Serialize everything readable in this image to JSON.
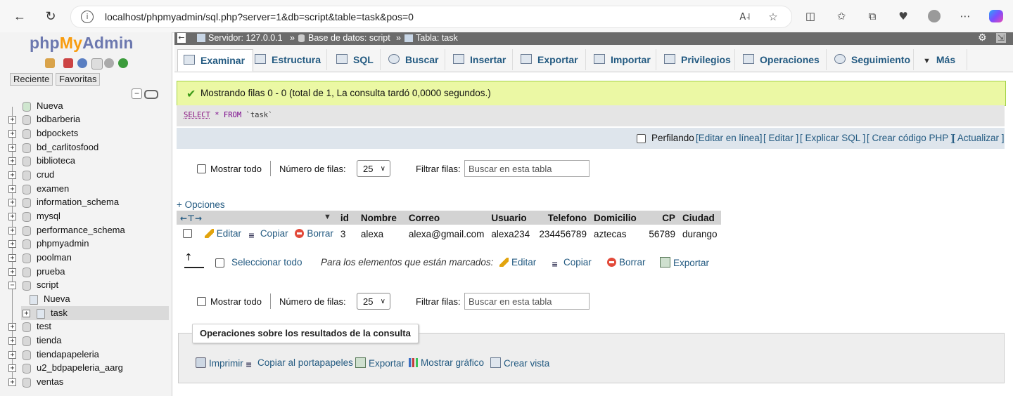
{
  "browser": {
    "url": "localhost/phpmyadmin/sql.php?server=1&db=script&table=task&pos=0"
  },
  "sidebar": {
    "logo": {
      "php": "php",
      "my": "My",
      "admin": "Admin"
    },
    "tabs": {
      "recent": "Reciente",
      "favorites": "Favoritas"
    },
    "tree": [
      {
        "label": "Nueva",
        "type": "new"
      },
      {
        "label": "bdbarberia",
        "type": "db"
      },
      {
        "label": "bdpockets",
        "type": "db"
      },
      {
        "label": "bd_carlitosfood",
        "type": "db"
      },
      {
        "label": "biblioteca",
        "type": "db"
      },
      {
        "label": "crud",
        "type": "db"
      },
      {
        "label": "examen",
        "type": "db"
      },
      {
        "label": "information_schema",
        "type": "db"
      },
      {
        "label": "mysql",
        "type": "db"
      },
      {
        "label": "performance_schema",
        "type": "db"
      },
      {
        "label": "phpmyadmin",
        "type": "db"
      },
      {
        "label": "poolman",
        "type": "db"
      },
      {
        "label": "prueba",
        "type": "db"
      },
      {
        "label": "script",
        "type": "db-open"
      },
      {
        "label": "Nueva",
        "type": "sub-new"
      },
      {
        "label": "task",
        "type": "sub-table"
      },
      {
        "label": "test",
        "type": "db"
      },
      {
        "label": "tienda",
        "type": "db"
      },
      {
        "label": "tiendapapeleria",
        "type": "db"
      },
      {
        "label": "u2_bdpapeleria_aarg",
        "type": "db"
      },
      {
        "label": "ventas",
        "type": "db"
      }
    ]
  },
  "breadcrumb": {
    "server": "Servidor: 127.0.0.1",
    "db": "Base de datos: script",
    "table": "Tabla: task",
    "sep": "»"
  },
  "tabs": [
    {
      "label": "Examinar"
    },
    {
      "label": "Estructura"
    },
    {
      "label": "SQL"
    },
    {
      "label": "Buscar"
    },
    {
      "label": "Insertar"
    },
    {
      "label": "Exportar"
    },
    {
      "label": "Importar"
    },
    {
      "label": "Privilegios"
    },
    {
      "label": "Operaciones"
    },
    {
      "label": "Seguimiento"
    },
    {
      "label": "Más"
    }
  ],
  "message": "Mostrando filas 0 - 0 (total de 1, La consulta tardó 0,0000 segundos.)",
  "sql": {
    "select": "SELECT",
    "rest": " * FROM ",
    "table": "`task`"
  },
  "profiling": {
    "label": "Perfilando",
    "links": [
      "[Editar en línea]",
      "[ Editar ]",
      "[ Explicar SQL ]",
      "[ Crear código PHP ]",
      "[ Actualizar ]"
    ]
  },
  "nav": {
    "show_all": "Mostrar todo",
    "rows_label": "Número de filas:",
    "rows_value": "25",
    "filter_label": "Filtrar filas:",
    "filter_placeholder": "Buscar en esta tabla"
  },
  "options_link": "+ Opciones",
  "table": {
    "columns": [
      "id",
      "Nombre",
      "Correo",
      "Usuario",
      "Telefono",
      "Domicilio",
      "CP",
      "Ciudad"
    ],
    "row_actions": {
      "edit": "Editar",
      "copy": "Copiar",
      "delete": "Borrar"
    },
    "rows": [
      [
        "3",
        "alexa",
        "alexa@gmail.com",
        "alexa234",
        "234456789",
        "aztecas",
        "56789",
        "durango"
      ]
    ]
  },
  "bulk": {
    "select_all": "Seleccionar todo",
    "for_marked": "Para los elementos que están marcados:",
    "edit": "Editar",
    "copy": "Copiar",
    "delete": "Borrar",
    "export": "Exportar"
  },
  "ops": {
    "legend": "Operaciones sobre los resultados de la consulta",
    "print": "Imprimir",
    "copy_clipboard": "Copiar al portapapeles",
    "export": "Exportar",
    "chart": "Mostrar gráfico",
    "view": "Crear vista"
  }
}
